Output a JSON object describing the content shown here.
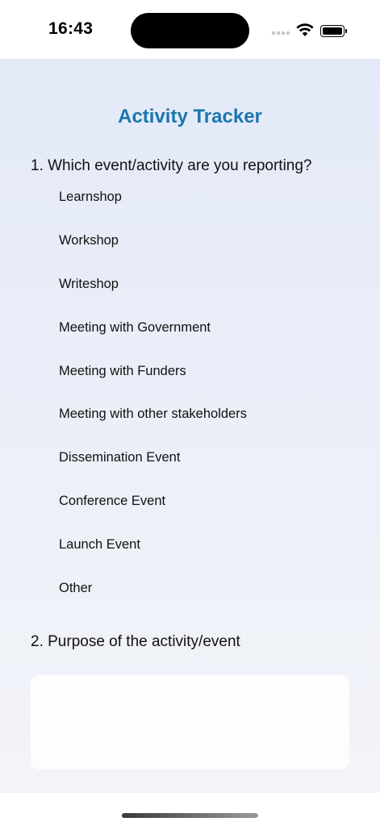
{
  "status_bar": {
    "time": "16:43",
    "icons": [
      "cellular-signal-icon",
      "wifi-icon",
      "battery-icon"
    ]
  },
  "page": {
    "title": "Activity Tracker"
  },
  "questions": [
    {
      "label": "1. Which event/activity are you reporting?",
      "options": [
        "Learnshop",
        "Workshop",
        "Writeshop",
        "Meeting with Government",
        "Meeting with Funders",
        "Meeting with other stakeholders",
        "Dissemination Event",
        "Conference Event",
        "Launch Event",
        "Other"
      ]
    },
    {
      "label": "2. Purpose of the activity/event",
      "value": "",
      "placeholder": ""
    }
  ],
  "colors": {
    "title": "#1a77ad",
    "background_top": "#e3e9f7",
    "background_bottom": "#f3f4f9",
    "input_background": "#fdfdfe"
  }
}
